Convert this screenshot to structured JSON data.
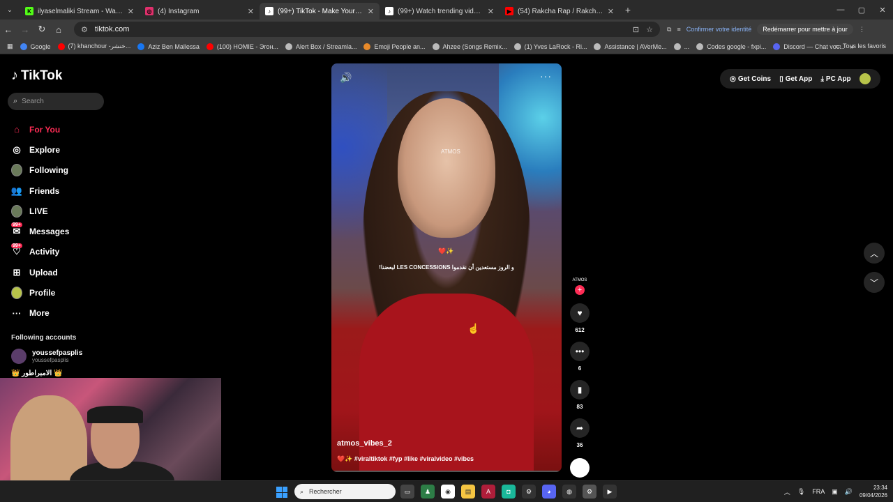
{
  "browser": {
    "tabs": [
      {
        "title": "ilyaselmaliki Stream - Watch Li",
        "fav_color": "#53fc18",
        "fav_glyph": "K",
        "active": false
      },
      {
        "title": "(4) Instagram",
        "fav_color": "#e1306c",
        "fav_glyph": "◎",
        "active": false
      },
      {
        "title": "(99+) TikTok - Make Your Da",
        "fav_color": "#ffffff",
        "fav_glyph": "♪",
        "active": true
      },
      {
        "title": "(99+) Watch trending videos fo",
        "fav_color": "#ffffff",
        "fav_glyph": "♪",
        "active": false
      },
      {
        "title": "(54) Rakcha Rap / Rakcha Prod",
        "fav_color": "#ff0000",
        "fav_glyph": "▶",
        "active": false
      }
    ],
    "url": "tiktok.com",
    "confirm_identity": "Confirmer votre identité",
    "restart_label": "Redémarrer pour mettre à jour",
    "bookmarks": [
      {
        "label": "Google",
        "color": "#4285f4"
      },
      {
        "label": "(7) khanchour -خنشر...",
        "color": "#ff0000"
      },
      {
        "label": "Aziz Ben Mallessa",
        "color": "#1877f2"
      },
      {
        "label": "(100) HOMIE - Эгон...",
        "color": "#ff0000"
      },
      {
        "label": "Alert Box / Streamla...",
        "color": "#bbbbbb"
      },
      {
        "label": "Emoji People an...",
        "color": "#e88a2a"
      },
      {
        "label": "Ahzee (Songs Remix...",
        "color": "#bbbbbb"
      },
      {
        "label": "(1) Yves LaRock - Ri...",
        "color": "#bbbbbb"
      },
      {
        "label": "Assistance | AVerMe...",
        "color": "#bbbbbb"
      },
      {
        "label": "...",
        "color": "#bbbbbb"
      },
      {
        "label": "Codes google - fxpi...",
        "color": "#bbbbbb"
      },
      {
        "label": "Discord — Chat voc...",
        "color": "#5865f2"
      }
    ],
    "all_bookmarks": "Tous les favoris"
  },
  "tiktok": {
    "logo": "TikTok",
    "search_placeholder": "Search",
    "nav": [
      {
        "label": "For You",
        "icon": "home-icon",
        "glyph": "⌂",
        "active": true,
        "badge": ""
      },
      {
        "label": "Explore",
        "icon": "compass-icon",
        "glyph": "◎",
        "active": false,
        "badge": ""
      },
      {
        "label": "Following",
        "icon": "avatar-icon",
        "glyph": "",
        "active": false,
        "badge": ""
      },
      {
        "label": "Friends",
        "icon": "friends-icon",
        "glyph": "👥",
        "active": false,
        "badge": ""
      },
      {
        "label": "LIVE",
        "icon": "live-icon",
        "glyph": "",
        "active": false,
        "badge": ""
      },
      {
        "label": "Messages",
        "icon": "message-icon",
        "glyph": "✉",
        "active": false,
        "badge": "99+"
      },
      {
        "label": "Activity",
        "icon": "bell-icon",
        "glyph": "♡",
        "active": false,
        "badge": "99+"
      },
      {
        "label": "Upload",
        "icon": "upload-icon",
        "glyph": "⊞",
        "active": false,
        "badge": ""
      },
      {
        "label": "Profile",
        "icon": "profile-icon",
        "glyph": "",
        "active": false,
        "badge": ""
      },
      {
        "label": "More",
        "icon": "more-icon",
        "glyph": "···",
        "active": false,
        "badge": ""
      }
    ],
    "following_header": "Following accounts",
    "account": {
      "name": "youssefpasplis",
      "handle": "youssefpasplis"
    },
    "account2": "👑 الامبراطور 👑",
    "topbar": {
      "coins": "Get Coins",
      "app": "Get App",
      "pc": "PC App"
    },
    "video": {
      "watermark": "ATMOS",
      "caption": "و الروز مستعدين أن نقدموا LES CONCESSIONS لبعضنا!",
      "author": "atmos_vibes_2",
      "hashtags": "❤️✨ #viraltiktok #fyp #like #viralvideo #vibes",
      "creator_label": "ATMOS"
    },
    "actions": [
      {
        "name": "like",
        "icon": "heart-icon",
        "glyph": "♥",
        "count": "612"
      },
      {
        "name": "comment",
        "icon": "comment-icon",
        "glyph": "•••",
        "count": "6"
      },
      {
        "name": "save",
        "icon": "bookmark-icon",
        "glyph": "▮",
        "count": "83"
      },
      {
        "name": "share",
        "icon": "share-icon",
        "glyph": "➦",
        "count": "36"
      }
    ]
  },
  "taskbar": {
    "search": "Rechercher",
    "lang": "FRA",
    "time": "23:34",
    "date": "09/04/2026"
  }
}
